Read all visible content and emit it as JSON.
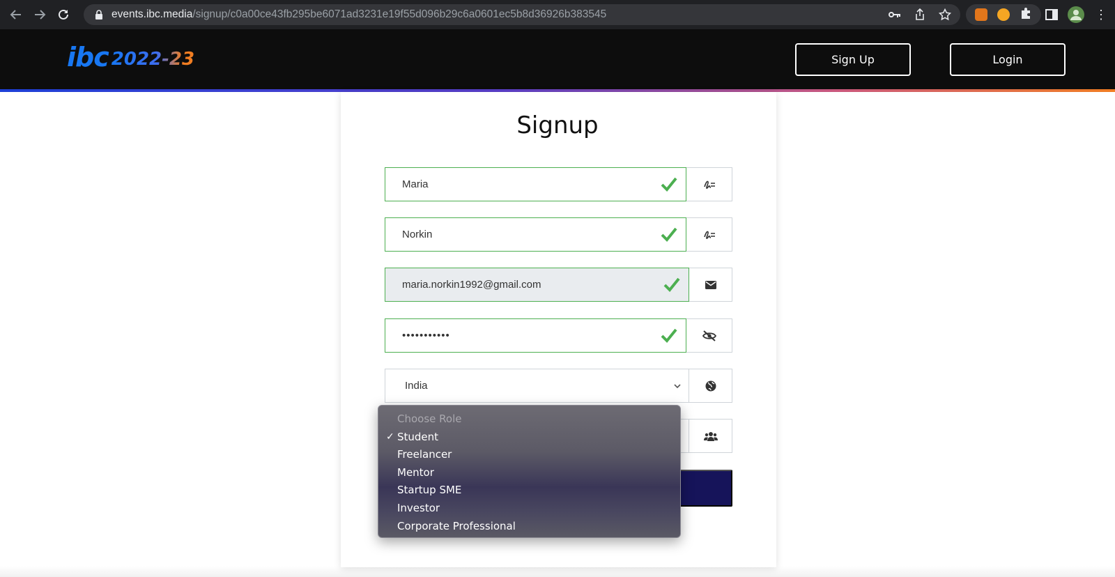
{
  "browser": {
    "url_host": "events.ibc.media",
    "url_path": "/signup/c0a00ce43fb295be6071ad3231e19f55d096b29c6a0601ec5b8d36926b383545"
  },
  "header": {
    "logo_ibc": "ibc",
    "logo_year": "2022-23",
    "signup_label": "Sign Up",
    "login_label": "Login"
  },
  "form": {
    "title": "Signup",
    "first_name": "Maria",
    "last_name": "Norkin",
    "email": "maria.norkin1992@gmail.com",
    "password_masked": "•••••••••••",
    "country": "India",
    "role_options": [
      {
        "label": "Choose Role",
        "disabled": true,
        "selected": false
      },
      {
        "label": "Student",
        "disabled": false,
        "selected": true
      },
      {
        "label": "Freelancer",
        "disabled": false,
        "selected": false
      },
      {
        "label": "Mentor",
        "disabled": false,
        "selected": false
      },
      {
        "label": "Startup SME",
        "disabled": false,
        "selected": false
      },
      {
        "label": "Investor",
        "disabled": false,
        "selected": false
      },
      {
        "label": "Corporate Professional",
        "disabled": false,
        "selected": false
      }
    ],
    "selected_mark": "✓"
  },
  "icons": {
    "first_name_addon": "signature-icon",
    "last_name_addon": "signature-icon",
    "email_addon": "envelope-icon",
    "password_addon": "eye-slash-icon",
    "country_addon": "globe-icon",
    "role_addon": "users-icon",
    "valid": "check-icon"
  },
  "colors": {
    "valid_border": "#4caf50",
    "submit_bg": "#16145a",
    "header_bg": "#0d0d0d",
    "logo_blue": "#1877f2",
    "logo_orange": "#f07d22"
  }
}
